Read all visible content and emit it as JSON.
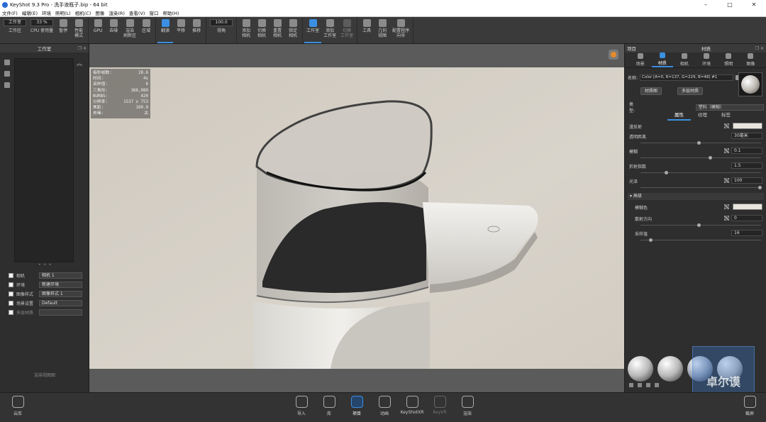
{
  "window": {
    "title": "KeyShot 9.3 Pro - 洗手液瓶子.bip - 64 bit",
    "minimize": "–",
    "maximize": "□",
    "close": "✕"
  },
  "menu": [
    "文件(F)",
    "编辑(E)",
    "环境",
    "照明(L)",
    "相机(C)",
    "图像",
    "渲染(R)",
    "查看(V)",
    "窗口",
    "帮助(H)"
  ],
  "toolbar": {
    "workspace_select": "工作室",
    "zoom_value": "33 %",
    "focal_value": "100.0",
    "buttons": {
      "workspace": "工作区",
      "cpu": "CPU 使用量",
      "pause": "暂停",
      "perf_mode": "性能\n模式",
      "gpu": "GPU",
      "denoise": "去噪",
      "render_region": "渲染\n刷新区",
      "region": "区域",
      "tumble": "翻滚",
      "pan": "平移",
      "dolly": "推移",
      "view": "视角",
      "add_camera": "添加\n相机",
      "switch_camera": "切换\n相机",
      "reset_camera": "重置\n相机",
      "lock_camera": "锁定\n相机",
      "studio": "工作室",
      "add_studio": "添加\n工作室",
      "switch_studio": "切换\n工作室",
      "tools": "工具",
      "geometry_view": "几何\n视图",
      "config_wizard": "配置程序\n向导"
    }
  },
  "left_panel": {
    "title": "工作室",
    "dots": "• • •",
    "options": [
      {
        "label": "相机",
        "value": "相机 1"
      },
      {
        "label": "环境",
        "value": "新建环境"
      },
      {
        "label": "图像样式",
        "value": "图像样式 1"
      },
      {
        "label": "场景设置",
        "value": "Default"
      },
      {
        "label": "多层材质",
        "value": ""
      }
    ],
    "footer": "渲染视图图"
  },
  "stats": [
    {
      "label": "每秒帧数:",
      "value": "28.6"
    },
    {
      "label": "时间:",
      "value": "4s"
    },
    {
      "label": "采样值:",
      "value": "6"
    },
    {
      "label": "三角形:",
      "value": "366,980"
    },
    {
      "label": "NURBS:",
      "value": "420"
    },
    {
      "label": "分辨率:",
      "value": "1537 x 753"
    },
    {
      "label": "焦距:",
      "value": "100.0"
    },
    {
      "label": "去噪:",
      "value": "关"
    }
  ],
  "right_panel": {
    "project_label": "项目",
    "material_label": "材质",
    "tabs": [
      {
        "label": "场景",
        "active": false
      },
      {
        "label": "材质",
        "active": true
      },
      {
        "label": "相机",
        "active": false
      },
      {
        "label": "环境",
        "active": false
      },
      {
        "label": "照明",
        "active": false
      },
      {
        "label": "图像",
        "active": false
      }
    ],
    "name_label": "名称:",
    "name_value": "Color [A=0, R=137, G=229, B=48] #1",
    "btn_graph": "材质图",
    "btn_multilayer": "多层材质",
    "type_label": "类型:",
    "type_value": "塑料（模糊）",
    "subtabs": [
      "属性",
      "纹理",
      "标签"
    ],
    "props": [
      {
        "label": "漫反射",
        "value": ""
      },
      {
        "label": "透明距离",
        "value": "30毫米"
      },
      {
        "label": "模糊",
        "value": "0.1"
      },
      {
        "label": "折射指数",
        "value": "1.5"
      },
      {
        "label": "光泽",
        "value": "100"
      }
    ],
    "advanced_title": "高级",
    "advanced_props": [
      {
        "label": "模糊色",
        "value": ""
      },
      {
        "label": "散射方向",
        "value": "0"
      },
      {
        "label": "采样值",
        "value": "16"
      }
    ]
  },
  "watermark": "卓尔谟",
  "bottom_bar": [
    {
      "label": "云库"
    },
    {
      "label": "导入"
    },
    {
      "label": "库"
    },
    {
      "label": "项目"
    },
    {
      "label": "动画"
    },
    {
      "label": "KeyShotXR"
    },
    {
      "label": "KeyVR"
    },
    {
      "label": "渲染"
    },
    {
      "label": "截屏"
    }
  ]
}
